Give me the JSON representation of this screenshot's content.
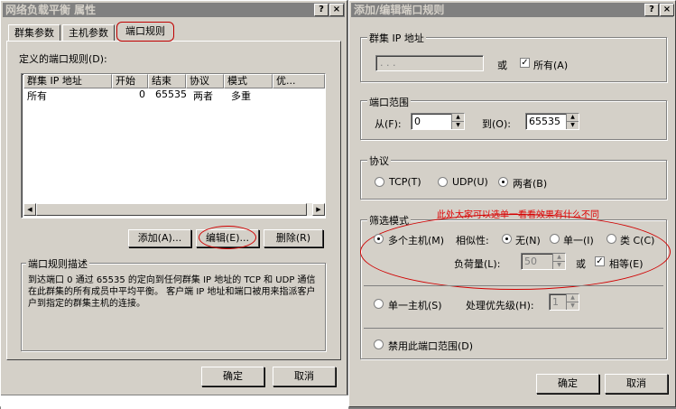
{
  "left_window": {
    "title": "网络负载平衡 属性",
    "help_btn": "?",
    "close_btn": "×",
    "tabs": [
      "群集参数",
      "主机参数",
      "端口规则"
    ],
    "rules_label": "定义的端口规则(D):",
    "columns": [
      "群集 IP 地址",
      "开始",
      "结束",
      "协议",
      "模式",
      "优..."
    ],
    "rows": [
      [
        "所有",
        "0",
        "65535",
        "两者",
        "多重",
        ""
      ]
    ],
    "buttons": {
      "add": "添加(A)...",
      "edit": "编辑(E)...",
      "delete": "删除(R)"
    },
    "desc_group": "端口规则描述",
    "desc_text": "到达端口 0 通过 65535 的定向到任何群集 IP 地址的 TCP 和 UDP 通信在此群集的所有成员中平均平衡。 客户端 IP 地址和端口被用来指派客户户到指定的群集主机的连接。",
    "ok": "确定",
    "cancel": "取消"
  },
  "right_window": {
    "title": "添加/编辑端口规则",
    "help_btn": "?",
    "close_btn": "×",
    "cluster_ip_group": "群集 IP 地址",
    "ip_value": "  .   .   .",
    "or": "或",
    "all_label": "所有(A)",
    "all_checked": true,
    "port_range_group": "端口范围",
    "from_label": "从(F):",
    "from_value": "0",
    "to_label": "到(O):",
    "to_value": "65535",
    "protocol_group": "协议",
    "protocols": [
      "TCP(T)",
      "UDP(U)",
      "两者(B)"
    ],
    "protocol_selected": "两者(B)",
    "filter_group": "筛选模式",
    "annotation": "此处大家可以选单一看看效果有什么不同",
    "multi_host": "多个主机(M)",
    "affinity_label": "相似性:",
    "affinity_options": [
      "无(N)",
      "单一(I)",
      "类 C(C)"
    ],
    "affinity_selected": "无(N)",
    "load_label": "负荷量(L):",
    "load_value": "50",
    "load_or": "或",
    "equal_label": "相等(E)",
    "equal_checked": true,
    "single_host": "单一主机(S)",
    "priority_label": "处理优先级(H):",
    "priority_value": "1",
    "disable_range": "禁用此端口范围(D)",
    "ok": "确定",
    "cancel": "取消"
  }
}
